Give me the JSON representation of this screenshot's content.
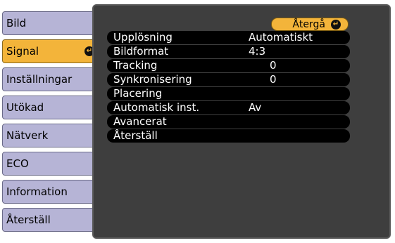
{
  "sidebar": {
    "items": [
      {
        "label": "Bild"
      },
      {
        "label": "Signal"
      },
      {
        "label": "Inställningar"
      },
      {
        "label": "Utökad"
      },
      {
        "label": "Nätverk"
      },
      {
        "label": "ECO"
      },
      {
        "label": "Information"
      },
      {
        "label": "Återställ"
      }
    ],
    "selected_index": 1
  },
  "panel": {
    "back_label": "Återgå",
    "rows": [
      {
        "label": "Upplösning",
        "value": "Automatiskt"
      },
      {
        "label": "Bildformat",
        "value": "4:3"
      },
      {
        "label": "Tracking",
        "value": "0"
      },
      {
        "label": "Synkronisering",
        "value": "0"
      },
      {
        "label": "Placering",
        "value": ""
      },
      {
        "label": "Automatisk inst.",
        "value": "Av"
      },
      {
        "label": "Avancerat",
        "value": ""
      },
      {
        "label": "Återställ",
        "value": ""
      }
    ]
  },
  "icons": {
    "enter": "enter-return-icon"
  },
  "colors": {
    "menu_item": "#b6b4d6",
    "selected": "#f3b43a",
    "panel": "#3e3e3e",
    "row": "#000000"
  }
}
